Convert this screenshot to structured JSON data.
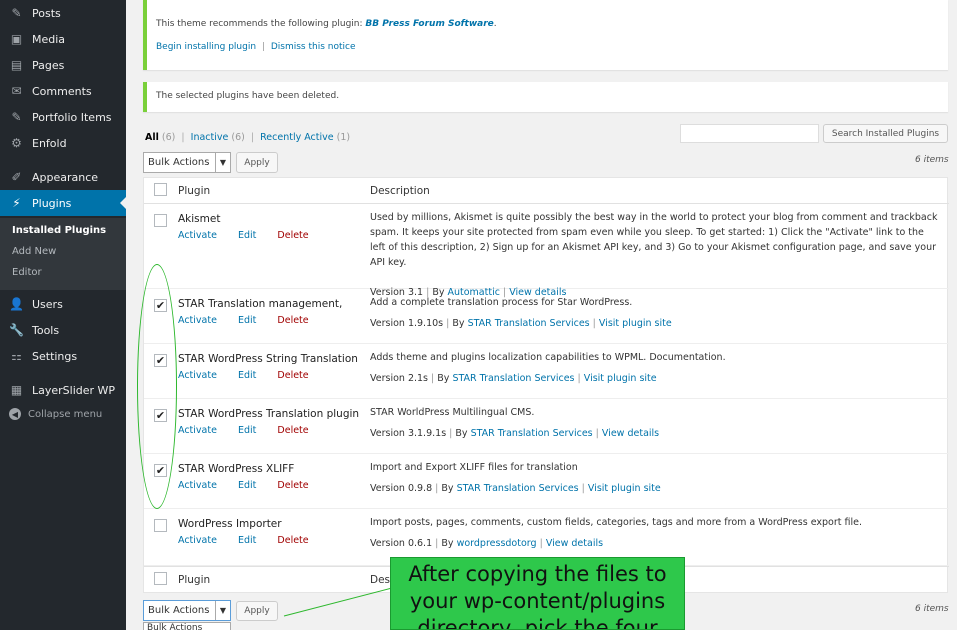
{
  "sidebar": {
    "items": [
      {
        "label": "Posts",
        "icon": "pin-icon",
        "glyph": "✎"
      },
      {
        "label": "Media",
        "icon": "media-icon",
        "glyph": "▣"
      },
      {
        "label": "Pages",
        "icon": "pages-icon",
        "glyph": "▤"
      },
      {
        "label": "Comments",
        "icon": "comment-icon",
        "glyph": "✉"
      },
      {
        "label": "Portfolio Items",
        "icon": "pin-icon",
        "glyph": "✎"
      },
      {
        "label": "Enfold",
        "icon": "gear-icon",
        "glyph": "⚙"
      },
      {
        "label": "Appearance",
        "icon": "brush-icon",
        "glyph": "✐"
      },
      {
        "label": "Plugins",
        "icon": "plug-icon",
        "glyph": "⚡"
      },
      {
        "label": "Users",
        "icon": "user-icon",
        "glyph": "👤"
      },
      {
        "label": "Tools",
        "icon": "wrench-icon",
        "glyph": "🔧"
      },
      {
        "label": "Settings",
        "icon": "settings-icon",
        "glyph": "⚏"
      },
      {
        "label": "LayerSlider WP",
        "icon": "layers-icon",
        "glyph": "▦"
      }
    ],
    "submenu": [
      "Installed Plugins",
      "Add New",
      "Editor"
    ],
    "collapse_label": "Collapse menu"
  },
  "notice1": {
    "text": "This theme recommends the following plugin:",
    "plugin": "BB Press Forum Software",
    "begin": "Begin installing plugin",
    "sep": "|",
    "dismiss": "Dismiss this notice"
  },
  "notice2": {
    "text": "The selected plugins have been deleted."
  },
  "filters": {
    "all": "All",
    "all_count": "(6)",
    "inactive": "Inactive",
    "inactive_count": "(6)",
    "recent": "Recently Active",
    "recent_count": "(1)",
    "sep": "|"
  },
  "search": {
    "button": "Search Installed Plugins"
  },
  "bulk": {
    "select": "Bulk Actions",
    "apply": "Apply",
    "items": "6 items",
    "open_option": "Bulk Actions"
  },
  "table": {
    "col_plugin": "Plugin",
    "col_description": "Description",
    "footer_plugin": "Plugin",
    "footer_description": "Desc"
  },
  "action_labels": {
    "activate": "Activate",
    "edit": "Edit",
    "delete": "Delete"
  },
  "plugins": [
    {
      "name": "Akismet",
      "checked": false,
      "description": "Used by millions, Akismet is quite possibly the best way in the world to protect your blog from comment and trackback spam. It keeps your site protected from spam even while you sleep. To get started: 1) Click the \"Activate\" link to the left of this description, 2) Sign up for an Akismet API key, and 3) Go to your Akismet configuration page, and save your API key.",
      "version": "Version 3.1",
      "by": "By",
      "author": "Automattic",
      "link": "View details"
    },
    {
      "name": "STAR Translation management,",
      "checked": true,
      "description": "Add a complete translation process for Star WordPress.",
      "version": "Version 1.9.10s",
      "by": "By",
      "author": "STAR Translation Services",
      "link": "Visit plugin site"
    },
    {
      "name": "STAR WordPress String Translation",
      "checked": true,
      "description": "Adds theme and plugins localization capabilities to WPML. Documentation.",
      "version": "Version 2.1s",
      "by": "By",
      "author": "STAR Translation Services",
      "link": "Visit plugin site"
    },
    {
      "name": "STAR WordPress Translation plugin",
      "checked": true,
      "description": "STAR WorldPress Multilingual CMS.",
      "version": "Version 3.1.9.1s",
      "by": "By",
      "author": "STAR Translation Services",
      "link": "View details"
    },
    {
      "name": "STAR WordPress XLIFF",
      "checked": true,
      "description": "Import and Export XLIFF files for translation",
      "version": "Version 0.9.8",
      "by": "By",
      "author": "STAR Translation Services",
      "link": "Visit plugin site"
    },
    {
      "name": "WordPress Importer",
      "checked": false,
      "description": "Import posts, pages, comments, custom fields, categories, tags and more from a WordPress export file.",
      "version": "Version 0.6.1",
      "by": "By",
      "author": "wordpressdotorg",
      "link": "View details"
    }
  ],
  "callout": {
    "text": "After copying the files to your wp-content/plugins directory, pick the four"
  },
  "colors": {
    "accent": "#0073aa",
    "sidebar": "#23282d",
    "notice_border": "#7ad03a",
    "delete": "#a00000",
    "callout": "#2ec84b"
  }
}
